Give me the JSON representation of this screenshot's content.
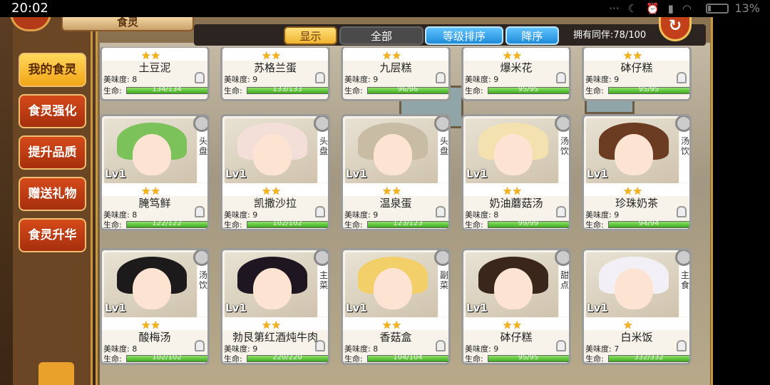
{
  "status_bar": {
    "time": "20:02",
    "battery": "13%"
  },
  "header": {
    "title": "食灵",
    "owned_label": "拥有同伴:",
    "owned_count": "78/100"
  },
  "filters": {
    "show_label": "显示",
    "all_label": "全部",
    "sort_label": "等级排序",
    "desc_label": "降序"
  },
  "side_menu": [
    {
      "label": "我的食灵",
      "active": true
    },
    {
      "label": "食灵强化",
      "active": false
    },
    {
      "label": "提升品质",
      "active": false
    },
    {
      "label": "赠送礼物",
      "active": false
    },
    {
      "label": "食灵升华",
      "active": false
    }
  ],
  "card_labels": {
    "taste": "美味度:",
    "hp": "生命:",
    "level": "Lv1"
  },
  "top_row": [
    {
      "name": "土豆泥",
      "stars": "★★",
      "taste": "8",
      "hp": "134/134",
      "hp_fraction": 1.0
    },
    {
      "name": "苏格兰蛋",
      "stars": "★★",
      "taste": "9",
      "hp": "133/133",
      "hp_fraction": 1.0
    },
    {
      "name": "九层糕",
      "stars": "★★",
      "taste": "9",
      "hp": "96/96",
      "hp_fraction": 1.0
    },
    {
      "name": "爆米花",
      "stars": "★★",
      "taste": "9",
      "hp": "95/95",
      "hp_fraction": 1.0
    },
    {
      "name": "砵仔糕",
      "stars": "★★",
      "taste": "9",
      "hp": "95/95",
      "hp_fraction": 1.0
    }
  ],
  "middle_row": [
    {
      "name": "腌笃鲜",
      "stars": "★★",
      "taste": "8",
      "hp": "122/122",
      "hp_fraction": 1.0,
      "type": "头盘",
      "hair": "#7cc25a"
    },
    {
      "name": "凯撒沙拉",
      "stars": "★★",
      "taste": "9",
      "hp": "102/102",
      "hp_fraction": 1.0,
      "type": "头盘",
      "hair": "#f4dfd8"
    },
    {
      "name": "温泉蛋",
      "stars": "★★",
      "taste": "9",
      "hp": "123/123",
      "hp_fraction": 1.0,
      "type": "头盘",
      "hair": "#c8bca5"
    },
    {
      "name": "奶油蘑菇汤",
      "stars": "★★",
      "taste": "8",
      "hp": "99/99",
      "hp_fraction": 1.0,
      "type": "汤饮",
      "hair": "#f3e2b0"
    },
    {
      "name": "珍珠奶茶",
      "stars": "★★",
      "taste": "9",
      "hp": "94/94",
      "hp_fraction": 1.0,
      "type": "汤饮",
      "hair": "#6b3b22"
    }
  ],
  "bottom_row": [
    {
      "name": "酸梅汤",
      "stars": "★★",
      "taste": "8",
      "hp": "102/102",
      "hp_fraction": 1.0,
      "type": "汤饮",
      "hair": "#1c1a1a"
    },
    {
      "name": "勃艮第红酒炖牛肉",
      "stars": "★★",
      "taste": "9",
      "hp": "220/220",
      "hp_fraction": 1.0,
      "type": "主菜",
      "hair": "#1e1722"
    },
    {
      "name": "香菇盒",
      "stars": "★★",
      "taste": "8",
      "hp": "104/104",
      "hp_fraction": 1.0,
      "type": "副菜",
      "hair": "#f3cf6a"
    },
    {
      "name": "砵仔糕",
      "stars": "★★",
      "taste": "9",
      "hp": "95/95",
      "hp_fraction": 1.0,
      "type": "甜点",
      "hair": "#3b261c"
    },
    {
      "name": "白米饭",
      "stars": "★",
      "taste": "7",
      "hp": "332/332",
      "hp_fraction": 1.0,
      "type": "主食",
      "hair": "#f2f0f6"
    }
  ]
}
